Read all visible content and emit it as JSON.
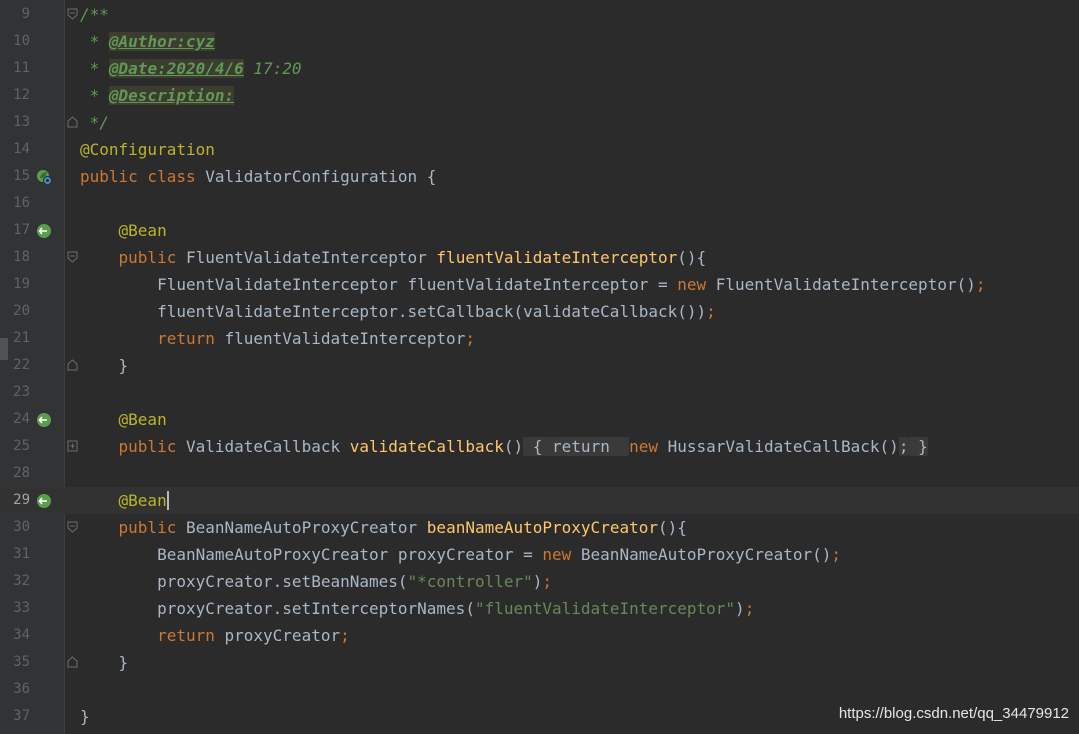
{
  "editor": {
    "lines": [
      {
        "num": "9",
        "fold": "open"
      },
      {
        "num": "10"
      },
      {
        "num": "11"
      },
      {
        "num": "12"
      },
      {
        "num": "13",
        "fold": "end"
      },
      {
        "num": "14"
      },
      {
        "num": "15",
        "icon": "spring-config-icon"
      },
      {
        "num": "16"
      },
      {
        "num": "17",
        "icon": "spring-bean-icon"
      },
      {
        "num": "18",
        "fold": "open"
      },
      {
        "num": "19"
      },
      {
        "num": "20"
      },
      {
        "num": "21"
      },
      {
        "num": "22",
        "fold": "end"
      },
      {
        "num": "23"
      },
      {
        "num": "24",
        "icon": "spring-bean-icon"
      },
      {
        "num": "25",
        "fold": "collapsed"
      },
      {
        "num": "28"
      },
      {
        "num": "29",
        "icon": "spring-bean-icon",
        "current": true
      },
      {
        "num": "30",
        "fold": "open"
      },
      {
        "num": "31"
      },
      {
        "num": "32"
      },
      {
        "num": "33"
      },
      {
        "num": "34"
      },
      {
        "num": "35",
        "fold": "end"
      },
      {
        "num": "36"
      },
      {
        "num": "37"
      }
    ],
    "code": {
      "l9": [
        "/**"
      ],
      "l10": [
        " * ",
        "@Author:cyz"
      ],
      "l11": [
        " * ",
        "@Date:2020/4/6",
        " 17:20"
      ],
      "l12": [
        " * ",
        "@Description:"
      ],
      "l13": [
        " */"
      ],
      "l14": [
        "@Configuration"
      ],
      "l15": [
        "public class ",
        "ValidatorConfiguration {"
      ],
      "l17": [
        "    ",
        "@Bean"
      ],
      "l18": [
        "    ",
        "public ",
        "FluentValidateInterceptor ",
        "fluentValidateInterceptor",
        "(){"
      ],
      "l19": [
        "        FluentValidateInterceptor fluentValidateInterceptor = ",
        "new ",
        "FluentValidateInterceptor()",
        ";"
      ],
      "l20": [
        "        fluentValidateInterceptor.setCallback(validateCallback())",
        ";"
      ],
      "l21": [
        "        ",
        "return ",
        "fluentValidateInterceptor",
        ";"
      ],
      "l22": [
        "    }"
      ],
      "l24": [
        "    ",
        "@Bean"
      ],
      "l25": [
        "    ",
        "public ",
        "ValidateCallback ",
        "validateCallback",
        "()",
        " { ",
        "return  ",
        "new ",
        "HussarValidateCallBack()",
        ";",
        " }"
      ],
      "l29": [
        "    ",
        "@Bean"
      ],
      "l30": [
        "    ",
        "public ",
        "BeanNameAutoProxyCreator ",
        "beanNameAutoProxyCreator",
        "(){"
      ],
      "l31": [
        "        BeanNameAutoProxyCreator proxyCreator = ",
        "new ",
        "BeanNameAutoProxyCreator()",
        ";"
      ],
      "l32": [
        "        proxyCreator.setBeanNames(",
        "\"*controller\"",
        ")",
        ";"
      ],
      "l33": [
        "        proxyCreator.setInterceptorNames(",
        "\"fluentValidateInterceptor\"",
        ")",
        ";"
      ],
      "l34": [
        "        ",
        "return ",
        "proxyCreator",
        ";"
      ],
      "l35": [
        "    }"
      ],
      "l37": [
        "}"
      ]
    }
  },
  "watermark": "https://blog.csdn.net/qq_34479912",
  "colors": {
    "background": "#2b2b2b",
    "keyword": "#cc7832",
    "annotation": "#bbb529",
    "method": "#ffc66d",
    "string": "#6a8759",
    "doc": "#629755",
    "text": "#a9b7c6"
  }
}
